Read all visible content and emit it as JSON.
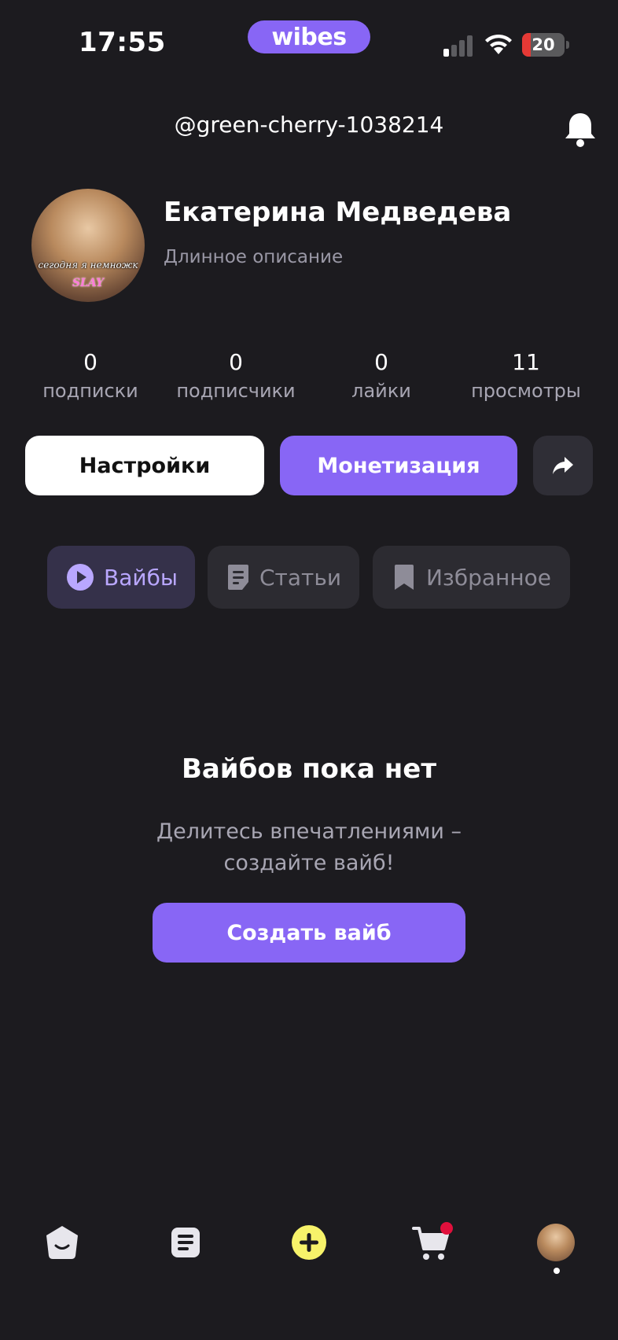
{
  "status_bar": {
    "time": "17:55",
    "brand": "wibes",
    "battery_level": "20",
    "icons": [
      "cellular-signal-icon",
      "wifi-icon",
      "battery-icon"
    ]
  },
  "header": {
    "username": "@green-cherry-1038214",
    "notification_icon": "bell-icon"
  },
  "profile": {
    "avatar_caption_line1": "сегодня я немножк",
    "avatar_caption_line2": "SLAY",
    "name": "Екатерина Медведева",
    "bio": "Длинное описание"
  },
  "stats": [
    {
      "value": "0",
      "label": "подписки"
    },
    {
      "value": "0",
      "label": "подписчики"
    },
    {
      "value": "0",
      "label": "лайки"
    },
    {
      "value": "11",
      "label": "просмотры"
    }
  ],
  "actions": {
    "settings_label": "Настройки",
    "monetization_label": "Монетизация",
    "share_icon": "share-arrow-icon"
  },
  "tabs": [
    {
      "label": "Вайбы",
      "icon": "play-icon",
      "active": true
    },
    {
      "label": "Статьи",
      "icon": "article-icon",
      "active": false
    },
    {
      "label": "Избранное",
      "icon": "bookmark-icon",
      "active": false
    }
  ],
  "empty_state": {
    "title": "Вайбов пока нет",
    "subtitle_line1": "Делитесь впечатлениями –",
    "subtitle_line2": "создайте вайб!",
    "button_label": "Создать вайб"
  },
  "bottom_nav": {
    "items": [
      "home-icon",
      "feed-icon",
      "create-plus-icon",
      "cart-icon",
      "profile-avatar"
    ],
    "cart_has_badge": true
  },
  "colors": {
    "background": "#1c1b1f",
    "accent": "#8866f5",
    "accent_light": "#b9a7ff",
    "create_yellow": "#f7f36a",
    "badge_red": "#e0103c"
  }
}
